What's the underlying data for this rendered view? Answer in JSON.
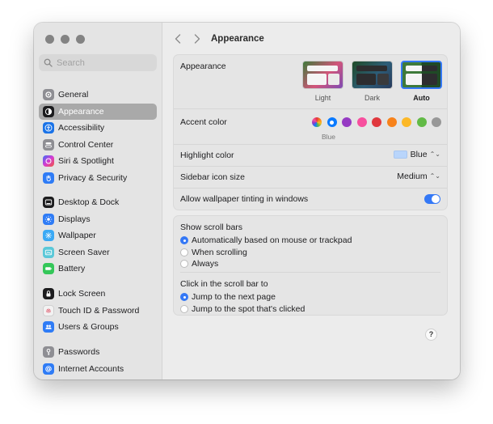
{
  "window": {
    "title": "Appearance"
  },
  "sidebar": {
    "search_placeholder": "Search",
    "groups": [
      [
        {
          "label": "General",
          "icon": "gear-icon",
          "color": "#8e8e93",
          "selected": false
        },
        {
          "label": "Appearance",
          "icon": "appearance-icon",
          "color": "#1c1c1e",
          "selected": true
        },
        {
          "label": "Accessibility",
          "icon": "accessibility-icon",
          "color": "#1a73e8",
          "selected": false
        },
        {
          "label": "Control Center",
          "icon": "control-center-icon",
          "color": "#8e8e93",
          "selected": false
        },
        {
          "label": "Siri & Spotlight",
          "icon": "siri-icon",
          "color": "#c548d2",
          "selected": false
        },
        {
          "label": "Privacy & Security",
          "icon": "hand-icon",
          "color": "#2f7cf6",
          "selected": false
        }
      ],
      [
        {
          "label": "Desktop & Dock",
          "icon": "dock-icon",
          "color": "#1c1c1e",
          "selected": false
        },
        {
          "label": "Displays",
          "icon": "displays-icon",
          "color": "#2f7cf6",
          "selected": false
        },
        {
          "label": "Wallpaper",
          "icon": "wallpaper-icon",
          "color": "#3aa9f5",
          "selected": false
        },
        {
          "label": "Screen Saver",
          "icon": "screen-saver-icon",
          "color": "#5ac8d8",
          "selected": false
        },
        {
          "label": "Battery",
          "icon": "battery-icon",
          "color": "#34c759",
          "selected": false
        }
      ],
      [
        {
          "label": "Lock Screen",
          "icon": "lock-icon",
          "color": "#1c1c1e",
          "selected": false
        },
        {
          "label": "Touch ID & Password",
          "icon": "fingerprint-icon",
          "color": "#f2f2f2",
          "selected": false
        },
        {
          "label": "Users & Groups",
          "icon": "users-icon",
          "color": "#2f7cf6",
          "selected": false
        }
      ],
      [
        {
          "label": "Passwords",
          "icon": "key-icon",
          "color": "#8e8e93",
          "selected": false
        },
        {
          "label": "Internet Accounts",
          "icon": "at-sign-icon",
          "color": "#2f7cf6",
          "selected": false
        }
      ]
    ]
  },
  "appearance": {
    "label": "Appearance",
    "options": [
      {
        "label": "Light",
        "selected": false
      },
      {
        "label": "Dark",
        "selected": false
      },
      {
        "label": "Auto",
        "selected": true
      }
    ]
  },
  "accent": {
    "label": "Accent color",
    "selected_name": "Blue",
    "colors": [
      "multicolor",
      "#0a7aff",
      "#953ac3",
      "#f74f9e",
      "#e0383e",
      "#f7821b",
      "#fcb827",
      "#62ba46",
      "#989898"
    ],
    "selected_index": 1
  },
  "highlight": {
    "label": "Highlight color",
    "value": "Blue"
  },
  "sidebar_icon_size": {
    "label": "Sidebar icon size",
    "value": "Medium"
  },
  "wallpaper_tinting": {
    "label": "Allow wallpaper tinting in windows",
    "on": true
  },
  "scroll_bars": {
    "title": "Show scroll bars",
    "options": [
      {
        "label": "Automatically based on mouse or trackpad",
        "selected": true
      },
      {
        "label": "When scrolling",
        "selected": false
      },
      {
        "label": "Always",
        "selected": false
      }
    ]
  },
  "scroll_click": {
    "title": "Click in the scroll bar to",
    "options": [
      {
        "label": "Jump to the next page",
        "selected": true
      },
      {
        "label": "Jump to the spot that's clicked",
        "selected": false
      }
    ]
  },
  "help_label": "?"
}
